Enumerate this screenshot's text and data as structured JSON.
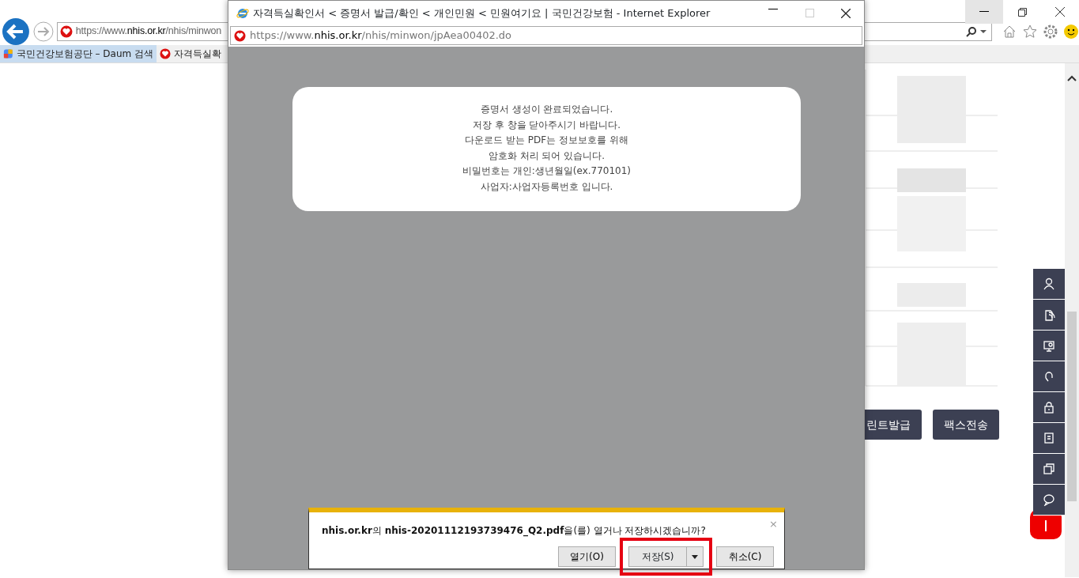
{
  "browser": {
    "address": "https://www.**nhis.or.kr**/nhis/minwon",
    "tabs": [
      {
        "title": "국민건강보험공단 – Daum 검색",
        "selected": true
      },
      {
        "title": "자격득실확",
        "selected": false
      }
    ]
  },
  "page": {
    "buttons": [
      "린트발급",
      "팩스전송"
    ]
  },
  "popup": {
    "title": "자격득실확인서 < 증명서 발급/확인 < 개인민원 < 민원여기요 | 국민건강보험 - Internet Explorer",
    "address": "https://www.**nhis.or.kr**/nhis/minwon/jpAea00402.do",
    "message": [
      "증명서 생성이 완료되었습니다.",
      "저장 후 창을 닫아주시기 바랍니다.",
      "다운로드 받는 PDF는 정보보호를 위해",
      "암호화 처리 되어 있습니다.",
      "비밀번호는 개인:생년월일(ex.770101)",
      "사업자:사업자등록번호 입니다."
    ],
    "download": {
      "close": "×",
      "message": "**nhis.or.kr**의 **nhis-20201112193739476_Q2.pdf**을(를) 열거나 저장하시겠습니까?",
      "buttons": [
        {
          "label": "열기(O)",
          "kind": "plain",
          "highlighted": false
        },
        {
          "label": "저장(S)",
          "kind": "split",
          "highlighted": true
        },
        {
          "label": "취소(C)",
          "kind": "plain",
          "highlighted": false
        }
      ]
    }
  }
}
